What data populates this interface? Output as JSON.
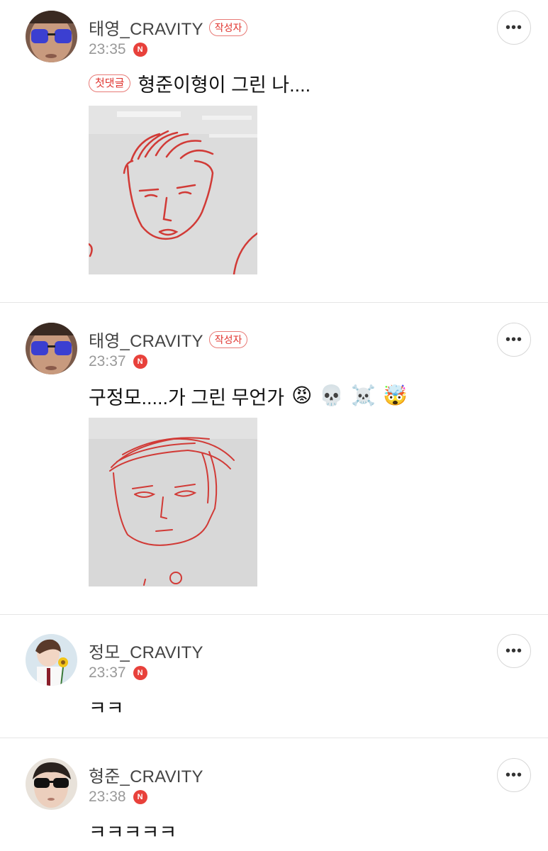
{
  "comments": [
    {
      "username": "태영_CRAVITY",
      "author_badge": "작성자",
      "time": "23:35",
      "new_badge": "N",
      "first_badge": "첫댓글",
      "text": "형준이형이 그린 나....",
      "more_label": "•••"
    },
    {
      "username": "태영_CRAVITY",
      "author_badge": "작성자",
      "time": "23:37",
      "new_badge": "N",
      "text": "구정모.....가 그린 무언가",
      "emojis": [
        "😡",
        "💀",
        "☠️",
        "🤯"
      ],
      "more_label": "•••"
    },
    {
      "username": "정모_CRAVITY",
      "time": "23:37",
      "new_badge": "N",
      "text": "ㅋㅋ",
      "more_label": "•••"
    },
    {
      "username": "형준_CRAVITY",
      "time": "23:38",
      "new_badge": "N",
      "text": "ㅋㅋㅋㅋㅋ",
      "more_label": "•••"
    }
  ],
  "colors": {
    "accent_red": "#e0342f",
    "badge_red": "#e8413b",
    "divider": "#e6e6e6",
    "time_gray": "#999999"
  }
}
